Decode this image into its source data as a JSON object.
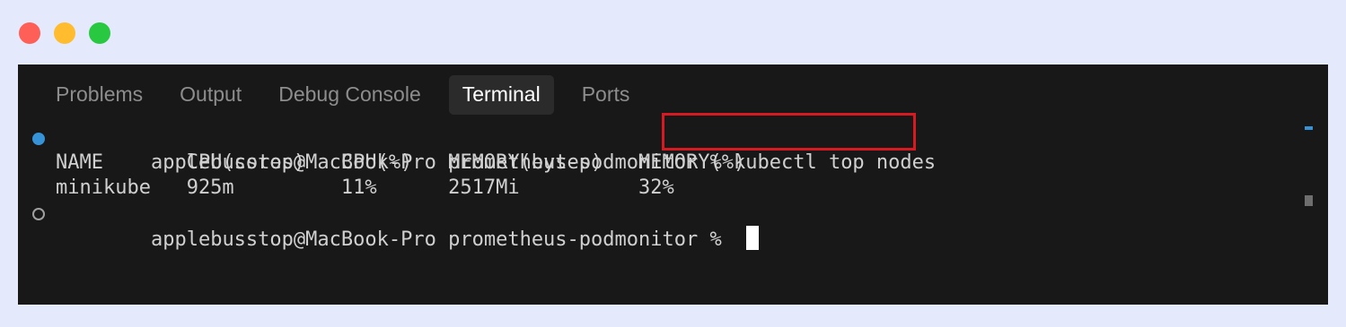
{
  "window": {
    "controls": [
      "close",
      "minimize",
      "maximize"
    ]
  },
  "panel": {
    "tabs": [
      {
        "label": "Problems",
        "active": false
      },
      {
        "label": "Output",
        "active": false
      },
      {
        "label": "Debug Console",
        "active": false
      },
      {
        "label": "Terminal",
        "active": true
      },
      {
        "label": "Ports",
        "active": false
      }
    ]
  },
  "terminal": {
    "prompt": "applebusstop@MacBook-Pro prometheus-podmonitor % ",
    "command": "kubectl top nodes",
    "table_header": "NAME       CPU(cores)   CPU(%)   MEMORY(bytes)   MEMORY(%)",
    "table_row": "minikube   925m         11%      2517Mi          32%",
    "prompt_2": "applebusstop@MacBook-Pro prometheus-podmonitor % ",
    "highlight_color": "#d71921"
  }
}
